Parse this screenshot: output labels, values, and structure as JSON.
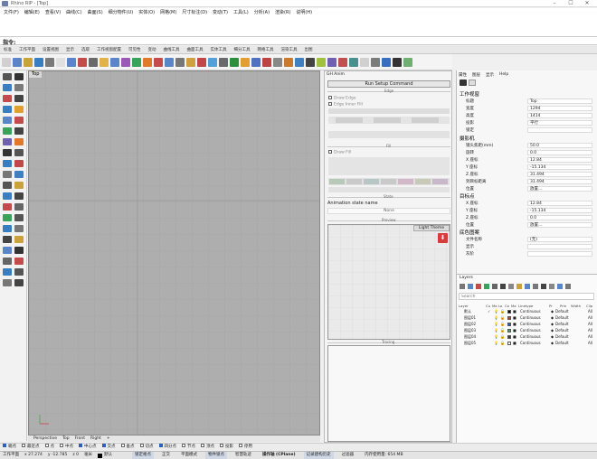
{
  "window": {
    "title": "Rhino RIP - [Top]"
  },
  "menu": [
    "文件(F)",
    "编辑(E)",
    "查看(V)",
    "曲线(C)",
    "曲面(S)",
    "细分物件(U)",
    "实体(O)",
    "网格(M)",
    "尺寸标注(D)",
    "变动(T)",
    "工具(L)",
    "分析(A)",
    "渲染(R)",
    "说明(H)"
  ],
  "command": {
    "label": "指令:"
  },
  "toolbar_tabs": [
    "标准",
    "工作平面",
    "设置视图",
    "显示",
    "选取",
    "工作视窗配置",
    "可见性",
    "变动",
    "曲线工具",
    "曲面工具",
    "实体工具",
    "细分工具",
    "网格工具",
    "渲染工具",
    "出图"
  ],
  "toolbar_icon_count": 38,
  "viewport": {
    "title": "Top",
    "tabs": [
      "Perspective",
      "Top",
      "Front",
      "Right",
      "+"
    ]
  },
  "ghpanel": {
    "title": "GH Anim",
    "run_button": "Run Setup Command",
    "edge_title": "Edge",
    "draw_edge": "Draw Edge",
    "edge_inner": "Edge Inner Fill",
    "fill_title": "Fill",
    "draw_fill": "Draw Fill",
    "state_title": "State",
    "anim_state_label": "Animation state name",
    "anim_state_value": "None",
    "preview_title": "Preview",
    "light_theme": "Light Theme",
    "tracing_title": "Tracing"
  },
  "props": {
    "tabs": [
      "属性",
      "图层",
      "显示",
      "Help"
    ],
    "section_workview": "工作视窗",
    "workview_rows": [
      {
        "k": "标题",
        "v": "Top"
      },
      {
        "k": "宽度",
        "v": "1294"
      },
      {
        "k": "高度",
        "v": "1414"
      },
      {
        "k": "投影",
        "v": "平行"
      },
      {
        "k": "锁定",
        "v": ""
      }
    ],
    "section_camera": "摄影机",
    "camera_rows": [
      {
        "k": "镜头焦距(mm)",
        "v": "50.0"
      },
      {
        "k": "旋转",
        "v": "0.0"
      },
      {
        "k": "X 座标",
        "v": "12.84"
      },
      {
        "k": "Y 座标",
        "v": "-15.134"
      },
      {
        "k": "Z 座标",
        "v": "31.494"
      },
      {
        "k": "到目标距离",
        "v": "31.494"
      },
      {
        "k": "位置",
        "v": "放置..."
      }
    ],
    "section_target": "目标点",
    "target_rows": [
      {
        "k": "X 座标",
        "v": "12.84"
      },
      {
        "k": "Y 座标",
        "v": "-15.134"
      },
      {
        "k": "Z 座标",
        "v": "0.0"
      },
      {
        "k": "位置",
        "v": "放置..."
      }
    ],
    "section_wallpaper": "底色图案",
    "wallpaper_rows": [
      {
        "k": "文件名称",
        "v": "(无)"
      },
      {
        "k": "显示",
        "v": ""
      },
      {
        "k": "灰阶",
        "v": ""
      }
    ]
  },
  "layers": {
    "title": "Layers",
    "search_placeholder": "Search",
    "headers": [
      "Layer",
      "Cu",
      "Ma",
      "Lo",
      "Co",
      "Ma",
      "Linetype",
      "Pr",
      "Prin",
      "Width",
      "Clip"
    ],
    "rows": [
      {
        "name": "默认",
        "current": "✓",
        "color": "#000000",
        "linetype": "Continuous",
        "print": "Default",
        "clip": "All"
      },
      {
        "name": "图层01",
        "current": "",
        "color": "#c23b3b",
        "linetype": "Continuous",
        "print": "Default",
        "clip": "All"
      },
      {
        "name": "图层02",
        "current": "",
        "color": "#2e58c9",
        "linetype": "Continuous",
        "print": "Default",
        "clip": "All"
      },
      {
        "name": "图层03",
        "current": "",
        "color": "#3ea85a",
        "linetype": "Continuous",
        "print": "Default",
        "clip": "All"
      },
      {
        "name": "图层04",
        "current": "",
        "color": "#404040",
        "linetype": "Continuous",
        "print": "Default",
        "clip": "All"
      },
      {
        "name": "图层05",
        "current": "",
        "color": "#ffffff",
        "linetype": "Continuous",
        "print": "Default",
        "clip": "All"
      }
    ]
  },
  "osnap": [
    "端点",
    "最近点",
    "点",
    "中点",
    "中心点",
    "交点",
    "垂点",
    "切点",
    "四分点",
    "节点",
    "顶点",
    "投影",
    "停用"
  ],
  "status": {
    "cplane": "工作平面",
    "x": "x 27.274",
    "y": "y -12.785",
    "z": "z 0",
    "unit": "毫米",
    "layer": "默认",
    "buttons": [
      "锁定格点",
      "正交",
      "平面模式",
      "物件锁点",
      "智慧轨迹",
      "操作轴 (CPlane)",
      "记录建构历史",
      "过滤器",
      "内存使用量: 654 MB"
    ]
  }
}
